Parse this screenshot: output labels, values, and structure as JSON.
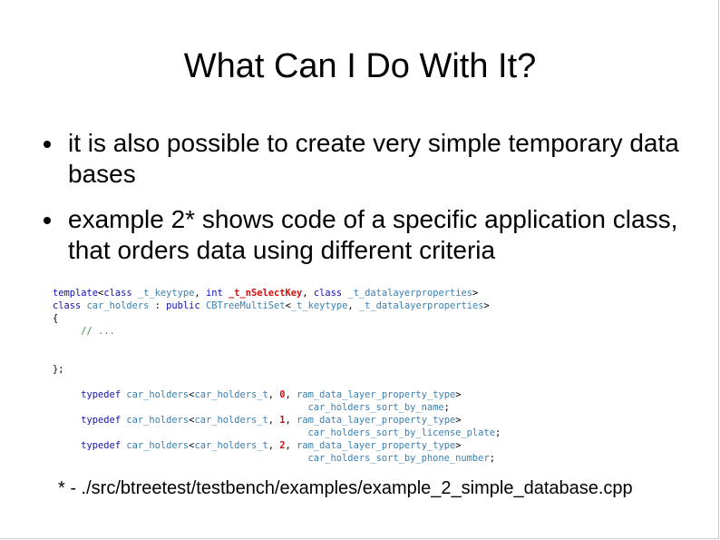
{
  "slide": {
    "title": "What Can I Do With It?",
    "bullets": [
      "it is also possible to create very simple temporary data bases",
      "example 2* shows code of a specific application class, that orders data using different criteria"
    ],
    "code_lines": [
      [
        {
          "t": "template",
          "c": "kw"
        },
        {
          "t": "<",
          "c": "plain"
        },
        {
          "t": "class",
          "c": "kw"
        },
        {
          "t": " ",
          "c": "plain"
        },
        {
          "t": "_t_keytype",
          "c": "ty"
        },
        {
          "t": ", ",
          "c": "plain"
        },
        {
          "t": "int",
          "c": "kw"
        },
        {
          "t": " ",
          "c": "plain"
        },
        {
          "t": "_t_nSelectKey",
          "c": "bold-red"
        },
        {
          "t": ", ",
          "c": "plain"
        },
        {
          "t": "class",
          "c": "kw"
        },
        {
          "t": " ",
          "c": "plain"
        },
        {
          "t": "_t_datalayerproperties",
          "c": "ty"
        },
        {
          "t": ">",
          "c": "plain"
        }
      ],
      [
        {
          "t": "class",
          "c": "kw"
        },
        {
          "t": " ",
          "c": "plain"
        },
        {
          "t": "car_holders",
          "c": "ty"
        },
        {
          "t": " : ",
          "c": "plain"
        },
        {
          "t": "public",
          "c": "kw"
        },
        {
          "t": " ",
          "c": "plain"
        },
        {
          "t": "CBTreeMultiSet",
          "c": "ty"
        },
        {
          "t": "<",
          "c": "plain"
        },
        {
          "t": "_t_keytype",
          "c": "ty"
        },
        {
          "t": ", ",
          "c": "plain"
        },
        {
          "t": "_t_datalayerproperties",
          "c": "ty"
        },
        {
          "t": ">",
          "c": "plain"
        }
      ],
      [
        {
          "t": "{",
          "c": "plain"
        }
      ],
      [
        {
          "t": "     ",
          "c": "plain"
        },
        {
          "t": "// ...",
          "c": "cm"
        }
      ],
      [
        {
          "t": "",
          "c": "plain"
        }
      ],
      [
        {
          "t": "",
          "c": "plain"
        }
      ],
      [
        {
          "t": "};",
          "c": "plain"
        }
      ],
      [
        {
          "t": "",
          "c": "plain"
        }
      ],
      [
        {
          "t": "     ",
          "c": "plain"
        },
        {
          "t": "typedef",
          "c": "kw"
        },
        {
          "t": " ",
          "c": "plain"
        },
        {
          "t": "car_holders",
          "c": "ty"
        },
        {
          "t": "<",
          "c": "plain"
        },
        {
          "t": "car_holders_t",
          "c": "ty"
        },
        {
          "t": ", ",
          "c": "plain"
        },
        {
          "t": "0",
          "c": "num"
        },
        {
          "t": ", ",
          "c": "plain"
        },
        {
          "t": "ram_data_layer_property_type",
          "c": "ty"
        },
        {
          "t": ">",
          "c": "plain"
        }
      ],
      [
        {
          "t": "                                             ",
          "c": "plain"
        },
        {
          "t": "car_holders_sort_by_name",
          "c": "ty"
        },
        {
          "t": ";",
          "c": "plain"
        }
      ],
      [
        {
          "t": "     ",
          "c": "plain"
        },
        {
          "t": "typedef",
          "c": "kw"
        },
        {
          "t": " ",
          "c": "plain"
        },
        {
          "t": "car_holders",
          "c": "ty"
        },
        {
          "t": "<",
          "c": "plain"
        },
        {
          "t": "car_holders_t",
          "c": "ty"
        },
        {
          "t": ", ",
          "c": "plain"
        },
        {
          "t": "1",
          "c": "num"
        },
        {
          "t": ", ",
          "c": "plain"
        },
        {
          "t": "ram_data_layer_property_type",
          "c": "ty"
        },
        {
          "t": ">",
          "c": "plain"
        }
      ],
      [
        {
          "t": "                                             ",
          "c": "plain"
        },
        {
          "t": "car_holders_sort_by_license_plate",
          "c": "ty"
        },
        {
          "t": ";",
          "c": "plain"
        }
      ],
      [
        {
          "t": "     ",
          "c": "plain"
        },
        {
          "t": "typedef",
          "c": "kw"
        },
        {
          "t": " ",
          "c": "plain"
        },
        {
          "t": "car_holders",
          "c": "ty"
        },
        {
          "t": "<",
          "c": "plain"
        },
        {
          "t": "car_holders_t",
          "c": "ty"
        },
        {
          "t": ", ",
          "c": "plain"
        },
        {
          "t": "2",
          "c": "num"
        },
        {
          "t": ", ",
          "c": "plain"
        },
        {
          "t": "ram_data_layer_property_type",
          "c": "ty"
        },
        {
          "t": ">",
          "c": "plain"
        }
      ],
      [
        {
          "t": "                                             ",
          "c": "plain"
        },
        {
          "t": "car_holders_sort_by_phone_number",
          "c": "ty"
        },
        {
          "t": ";",
          "c": "plain"
        }
      ]
    ],
    "footnote": "* - ./src/btreetest/testbench/examples/example_2_simple_database.cpp"
  },
  "colors": {
    "keyword": "#1010c0",
    "type": "#3a7fb0",
    "number": "#d01010",
    "comment": "#3a8a3a"
  }
}
